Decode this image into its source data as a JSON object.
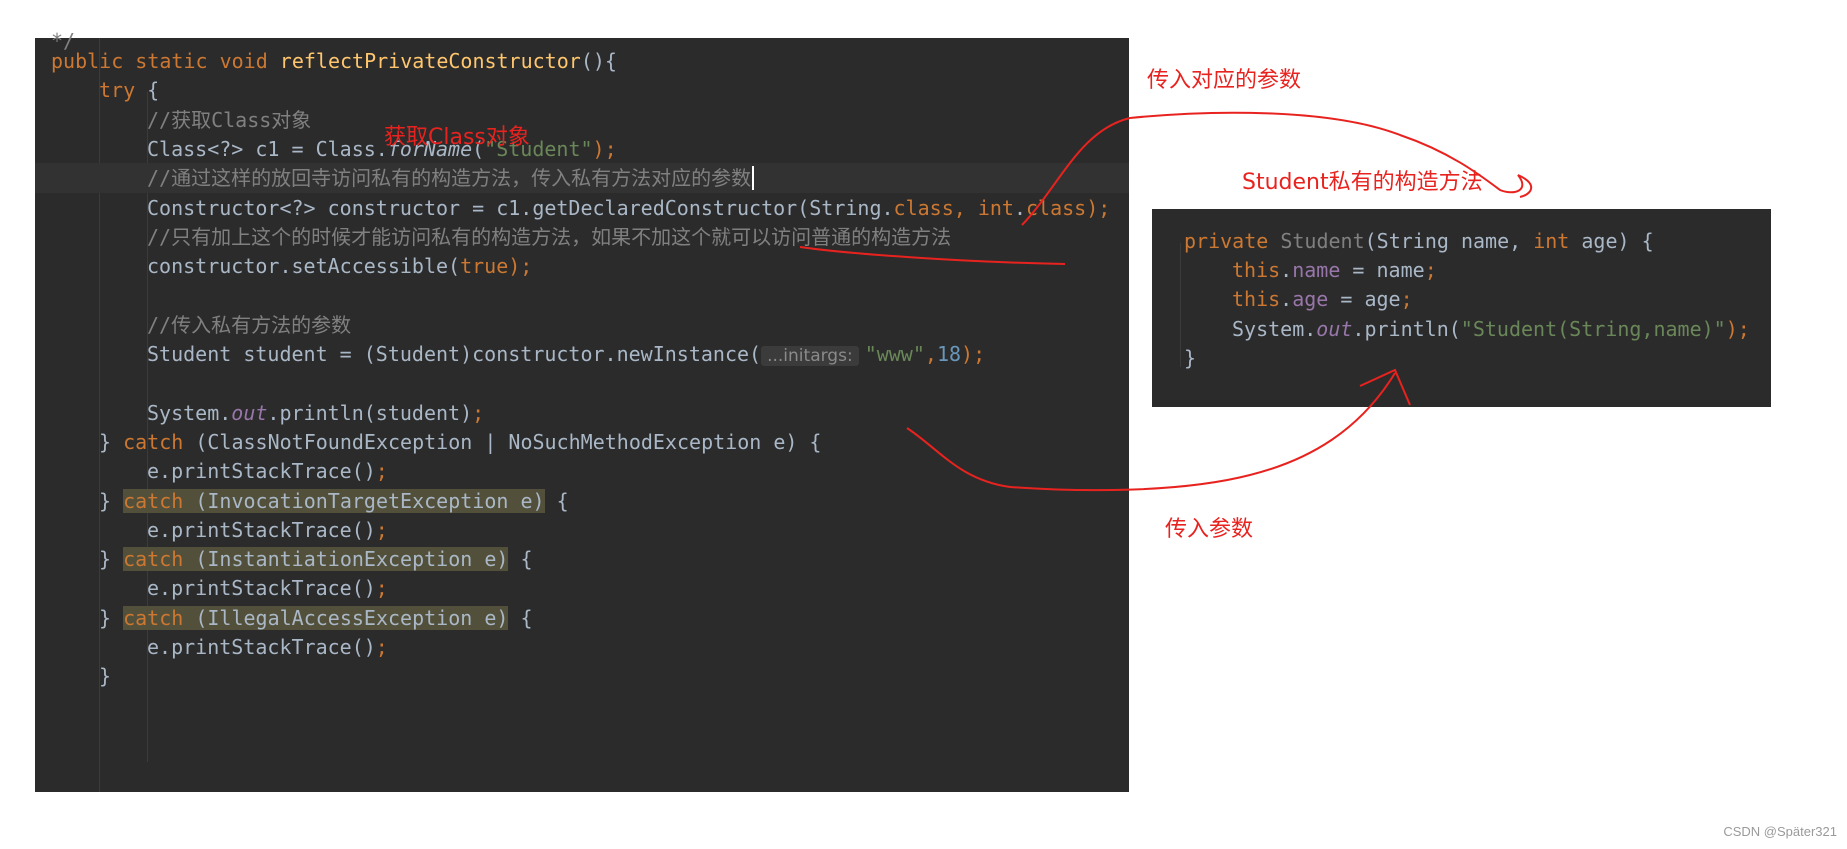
{
  "main_code": {
    "top_fragment": "*/",
    "lines": [
      {
        "indent": 0,
        "tokens": [
          {
            "t": "public static void ",
            "c": "kw"
          },
          {
            "t": "reflectPrivateConstructor",
            "c": "fn"
          },
          {
            "t": "(){",
            "c": ""
          }
        ]
      },
      {
        "indent": 1,
        "tokens": [
          {
            "t": "try ",
            "c": "kw"
          },
          {
            "t": "{",
            "c": ""
          }
        ]
      },
      {
        "indent": 2,
        "tokens": [
          {
            "t": "//获取Class对象",
            "c": "cm"
          }
        ]
      },
      {
        "indent": 2,
        "tokens": [
          {
            "t": "Class<?> c1 = Class.",
            "c": ""
          },
          {
            "t": "forName",
            "c": "static-it"
          },
          {
            "t": "(",
            "c": ""
          },
          {
            "t": "\"Student\"",
            "c": "str"
          },
          {
            "t": ");",
            "c": "kw"
          }
        ]
      },
      {
        "indent": 2,
        "highlight": true,
        "caret": true,
        "tokens": [
          {
            "t": "//通过这样的放回寺访问私有的构造方法，传入私有方法对应的参数",
            "c": "cm"
          }
        ]
      },
      {
        "indent": 2,
        "tokens": [
          {
            "t": "Constructor<?> constructor = c1.getDeclaredConstructor(String.",
            "c": ""
          },
          {
            "t": "class, int",
            "c": "kw"
          },
          {
            "t": ".",
            "c": ""
          },
          {
            "t": "class",
            "c": "kw"
          },
          {
            "t": ");",
            "c": "kw"
          }
        ]
      },
      {
        "indent": 2,
        "tokens": [
          {
            "t": "//只有加上这个的时候才能访问私有的构造方法，如果不加这个就可以访问普通的构造方法",
            "c": "cm"
          }
        ]
      },
      {
        "indent": 2,
        "tokens": [
          {
            "t": "constructor.setAccessible(",
            "c": ""
          },
          {
            "t": "true",
            "c": "kw"
          },
          {
            "t": ");",
            "c": "kw"
          }
        ]
      },
      {
        "indent": 0,
        "tokens": []
      },
      {
        "indent": 2,
        "tokens": [
          {
            "t": "//传入私有方法的参数",
            "c": "cm"
          }
        ]
      },
      {
        "indent": 2,
        "tokens": [
          {
            "t": "Student student = (Student)constructor.newInstance(",
            "c": ""
          },
          {
            "t": "...initargs:",
            "c": "hint"
          },
          {
            "t": "\"www\"",
            "c": "str"
          },
          {
            "t": ",",
            "c": "kw"
          },
          {
            "t": "18",
            "c": "num"
          },
          {
            "t": ");",
            "c": "kw"
          }
        ]
      },
      {
        "indent": 0,
        "tokens": []
      },
      {
        "indent": 2,
        "tokens": [
          {
            "t": "System.",
            "c": ""
          },
          {
            "t": "out",
            "c": "fld static-it"
          },
          {
            "t": ".println(student)",
            "c": ""
          },
          {
            "t": ";",
            "c": "kw"
          }
        ]
      },
      {
        "indent": 1,
        "tokens": [
          {
            "t": "} ",
            "c": ""
          },
          {
            "t": "catch ",
            "c": "kw"
          },
          {
            "t": "(ClassNotFoundException | NoSuchMethodException e) {",
            "c": ""
          }
        ]
      },
      {
        "indent": 2,
        "tokens": [
          {
            "t": "e.printStackTrace()",
            "c": ""
          },
          {
            "t": ";",
            "c": "kw"
          }
        ]
      },
      {
        "indent": 1,
        "tokens": [
          {
            "t": "} ",
            "c": ""
          },
          {
            "t": "catch ",
            "c": "kw warn-bg"
          },
          {
            "t": "(InvocationTargetException e)",
            "c": "warn-bg"
          },
          {
            "t": " {",
            "c": ""
          }
        ]
      },
      {
        "indent": 2,
        "tokens": [
          {
            "t": "e.printStackTrace()",
            "c": ""
          },
          {
            "t": ";",
            "c": "kw"
          }
        ]
      },
      {
        "indent": 1,
        "tokens": [
          {
            "t": "} ",
            "c": ""
          },
          {
            "t": "catch ",
            "c": "kw warn-bg"
          },
          {
            "t": "(InstantiationException e)",
            "c": "warn-bg"
          },
          {
            "t": " {",
            "c": ""
          }
        ]
      },
      {
        "indent": 2,
        "tokens": [
          {
            "t": "e.printStackTrace()",
            "c": ""
          },
          {
            "t": ";",
            "c": "kw"
          }
        ]
      },
      {
        "indent": 1,
        "tokens": [
          {
            "t": "} ",
            "c": ""
          },
          {
            "t": "catch ",
            "c": "kw warn-bg"
          },
          {
            "t": "(IllegalAccessException e)",
            "c": "warn-bg"
          },
          {
            "t": " {",
            "c": ""
          }
        ]
      },
      {
        "indent": 2,
        "tokens": [
          {
            "t": "e.printStackTrace()",
            "c": ""
          },
          {
            "t": ";",
            "c": "kw"
          }
        ]
      },
      {
        "indent": 1,
        "tokens": [
          {
            "t": "}",
            "c": ""
          }
        ]
      }
    ]
  },
  "constructor_code": {
    "lines": [
      {
        "indent": 0,
        "tokens": [
          {
            "t": "private ",
            "c": "kw"
          },
          {
            "t": "Student",
            "c": "dimcls"
          },
          {
            "t": "(String name, ",
            "c": ""
          },
          {
            "t": "int ",
            "c": "kw"
          },
          {
            "t": "age) {",
            "c": ""
          }
        ]
      },
      {
        "indent": 1,
        "tokens": [
          {
            "t": "this",
            "c": "kw"
          },
          {
            "t": ".",
            "c": ""
          },
          {
            "t": "name",
            "c": "fld"
          },
          {
            "t": " = name",
            "c": ""
          },
          {
            "t": ";",
            "c": "kw"
          }
        ]
      },
      {
        "indent": 1,
        "tokens": [
          {
            "t": "this",
            "c": "kw"
          },
          {
            "t": ".",
            "c": ""
          },
          {
            "t": "age",
            "c": "fld"
          },
          {
            "t": " = age",
            "c": ""
          },
          {
            "t": ";",
            "c": "kw"
          }
        ]
      },
      {
        "indent": 1,
        "tokens": [
          {
            "t": "System.",
            "c": ""
          },
          {
            "t": "out",
            "c": "fld static-it"
          },
          {
            "t": ".println(",
            "c": ""
          },
          {
            "t": "\"Student(String,name)\"",
            "c": "str"
          },
          {
            "t": ");",
            "c": "kw"
          }
        ]
      },
      {
        "indent": 0,
        "tokens": [
          {
            "t": "}",
            "c": ""
          }
        ]
      }
    ]
  },
  "annotations": {
    "get_class": "获取Class对象",
    "pass_params": "传入对应的参数",
    "private_ctor": "Student私有的构造方法",
    "pass_args": "传入参数"
  },
  "colors": {
    "editor_bg": "#2b2b2b",
    "annotation_red": "#e8231f",
    "keyword": "#cc7832",
    "string": "#6a8759",
    "comment": "#808080",
    "field": "#9876aa",
    "method_decl": "#ffc66d",
    "number": "#6897bb"
  },
  "watermark": "CSDN @Später321"
}
